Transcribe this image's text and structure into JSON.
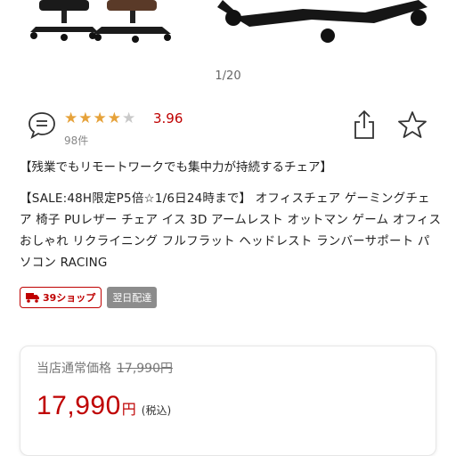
{
  "colors": {
    "accent_red": "#bf0000",
    "star_gold": "#e6a23a",
    "star_empty": "#c9c9c9",
    "muted": "#777777"
  },
  "gallery": {
    "pager": "1/20"
  },
  "review": {
    "icon": "speech-bubble-icon",
    "stars_filled": 4,
    "stars_total": 5,
    "score": "3.96",
    "count": "98件"
  },
  "actions": {
    "share_icon": "share-icon",
    "favorite_icon": "star-outline-icon"
  },
  "product": {
    "catch_copy": "【残業でもリモートワークでも集中力が持続するチェア】",
    "title": "【SALE:48H限定P5倍☆1/6日24時まで】 オフィスチェア ゲーミングチェア 椅子 PUレザー チェア イス 3D アームレスト オットマン ゲーム オフィス おしゃれ リクライニング フルフラット ヘッドレスト ランバーサポート パソコン RACING"
  },
  "badges": {
    "shop": "39ショップ",
    "delivery": "翌日配達"
  },
  "price": {
    "normal_label": "当店通常価格",
    "normal_value": "17,990円",
    "current_value": "17,990",
    "currency": "円",
    "tax_note": "(税込)"
  }
}
